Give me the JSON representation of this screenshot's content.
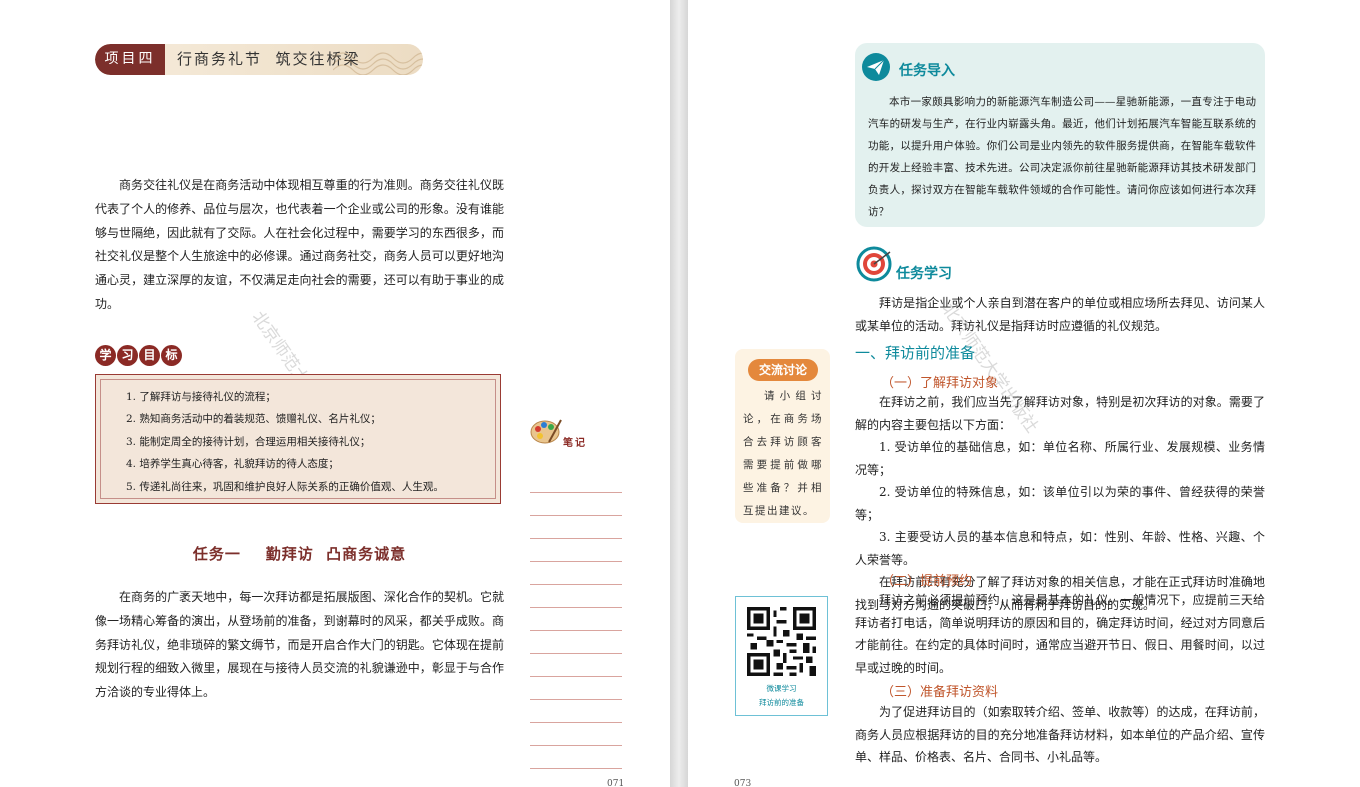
{
  "left_page": {
    "project_tag": "项目四",
    "project_title": "行商务礼节  筑交往桥梁",
    "intro": "商务交往礼仪是在商务活动中体现相互尊重的行为准则。商务交往礼仪既代表了个人的修养、品位与层次，也代表着一个企业或公司的形象。没有谁能够与世隔绝，因此就有了交际。人在社会化过程中，需要学习的东西很多，而社交礼仪是整个人生旅途中的必修课。通过商务社交，商务人员可以更好地沟通心灵，建立深厚的友谊，不仅满足走向社会的需要，还可以有助于事业的成功。",
    "objectives_title": [
      "学",
      "习",
      "目",
      "标"
    ],
    "objectives": [
      "1. 了解拜访与接待礼仪的流程；",
      "2. 熟知商务活动中的着装规范、馈赠礼仪、名片礼仪；",
      "3. 能制定周全的接待计划，合理运用相关接待礼仪；",
      "4. 培养学生真心待客，礼貌拜访的待人态度；",
      "5. 传递礼尚往来，巩固和维护良好人际关系的正确价值观、人生观。"
    ],
    "task_title": "任务一    勤拜访  凸商务诚意",
    "task_para": "在商务的广袤天地中，每一次拜访都是拓展版图、深化合作的契机。它就像一场精心筹备的演出，从登场前的准备，到谢幕时的风采，都关乎成败。商务拜访礼仪，绝非琐碎的繁文缛节，而是开启合作大门的钥匙。它体现在提前规划行程的细致入微里，展现在与接待人员交流的礼貌谦逊中，彰显于与合作方洽谈的专业得体上。",
    "notes_label": "笔记",
    "page_number": "071",
    "watermark": "北京师范大学出版社"
  },
  "right_page": {
    "task_intro_title": "任务导入",
    "task_intro_body": "本市一家颇具影响力的新能源汽车制造公司——星驰新能源，一直专注于电动汽车的研发与生产，在行业内崭露头角。最近，他们计划拓展汽车智能互联系统的功能，以提升用户体验。你们公司是业内领先的软件服务提供商，在智能车载软件的开发上经验丰富、技术先进。公司决定派你前往星驰新能源拜访其技术研发部门负责人，探讨双方在智能车载软件领域的合作可能性。请问你应该如何进行本次拜访？",
    "task_study_title": "任务学习",
    "definition": "拜访是指企业或个人亲自到潜在客户的单位或相应场所去拜见、访问某人或某单位的活动。拜访礼仪是指拜访时应遵循的礼仪规范。",
    "section1_title": "一、拜访前的准备",
    "sub1_title": "（一）了解拜访对象",
    "sub1_intro": "在拜访之前，我们应当先了解拜访对象，特别是初次拜访的对象。需要了解的内容主要包括以下方面：",
    "sub1_items": [
      "1. 受访单位的基础信息，如：单位名称、所属行业、发展规模、业务情况等；",
      "2. 受访单位的特殊信息，如：该单位引以为荣的事件、曾经获得的荣誉等；",
      "3. 主要受访人员的基本信息和特点，如：性别、年龄、性格、兴趣、个人荣誉等。"
    ],
    "sub1_conclusion": "在拜访前只有充分了解了拜访对象的相关信息，才能在正式拜访时准确地找到与对方沟通的突破口，从而有利于拜访目的的实现。",
    "sub2_title": "（二）提前预约",
    "sub2_body": "拜访之前必须提前预约，这是最基本的礼仪。一般情况下，应提前三天给拜访者打电话，简单说明拜访的原因和目的，确定拜访时间，经过对方同意后才能前往。在约定的具体时间时，通常应当避开节日、假日、用餐时间，以过早或过晚的时间。",
    "sub3_title": "（三）准备拜访资料",
    "sub3_body": "为了促进拜访目的（如索取转介绍、签单、收款等）的达成，在拜访前，商务人员应根据拜访的目的充分地准备拜访材料，如本单位的产品介绍、宣传单、样品、价格表、名片、合同书、小礼品等。",
    "discussion_tag": "交流讨论",
    "discussion_body": "请小组讨论，在商务场合去拜访顾客需要提前做哪些准备？并相互提出建议。",
    "qr_caption_line1": "微课学习",
    "qr_caption_line2": "拜访前的准备",
    "page_number": "073",
    "watermark": "北京师范大学出版社"
  },
  "colors": {
    "brand_red": "#7c2f2b",
    "teal": "#0e8a9c",
    "orange": "#e4883c",
    "card_bg": "#e3f1ef"
  }
}
